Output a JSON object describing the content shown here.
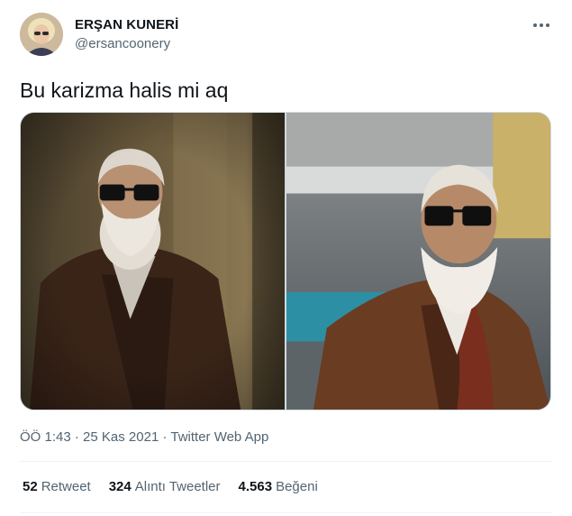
{
  "author": {
    "display_name": "ERŞAN KUNERİ",
    "handle": "@ersancoonery"
  },
  "tweet": {
    "text": "Bu karizma halis mi aq"
  },
  "media": {
    "count": 2
  },
  "meta": {
    "time": "ÖÖ 1:43",
    "date": "25 Kas 2021",
    "separator": " · ",
    "source": "Twitter Web App"
  },
  "stats": [
    {
      "count": "52",
      "label": "Retweet"
    },
    {
      "count": "324",
      "label": "Alıntı Tweetler"
    },
    {
      "count": "4.563",
      "label": "Beğeni"
    }
  ],
  "icons": {
    "more": "more-horizontal-icon"
  },
  "colors": {
    "text_primary": "#0f1419",
    "text_secondary": "#536471",
    "border": "#cfd9de",
    "divider": "#eff3f4"
  }
}
